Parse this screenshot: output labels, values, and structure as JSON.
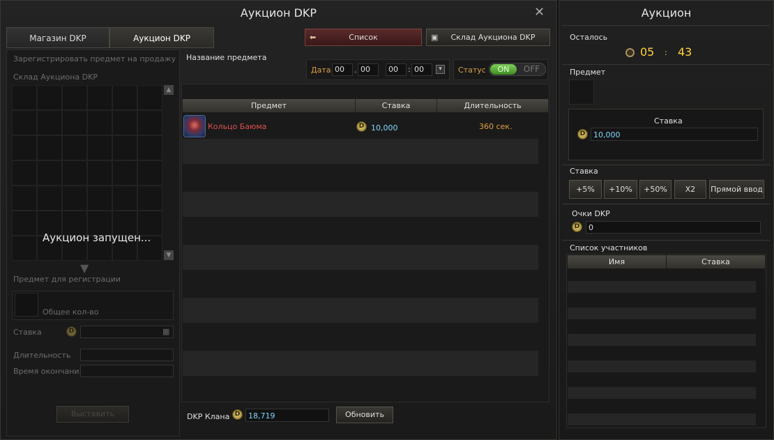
{
  "main": {
    "title": "Аукцион DKP",
    "tabs": [
      {
        "label": "Магазин DKP"
      },
      {
        "label": "Аукцион DKP"
      }
    ],
    "list_button": "Список",
    "warehouse_button": "Склад Аукциона DKP",
    "left": {
      "register_label": "Зарегистрировать предмет на продажу",
      "warehouse_label": "Склад Аукциона DKP",
      "overlay_text": "Аукцион запущен...",
      "item_for_reg_label": "Предмет для регистрации",
      "total_qty_label": "Общее кол-во",
      "bid_label": "Ставка",
      "duration_label": "Длительность",
      "end_time_label": "Время окончания",
      "submit_button": "Выставить"
    },
    "filter": {
      "item_name_label": "Название предмета",
      "date_label": "Дата",
      "date_month": "00",
      "date_day": "00",
      "time_hour": "00",
      "time_min": "00",
      "status_label": "Статус",
      "toggle_on": "ON",
      "toggle_off": "OFF"
    },
    "table": {
      "columns": [
        "Предмет",
        "Ставка",
        "Длительность"
      ],
      "rows": [
        {
          "item": "Кольцо Баюма",
          "bid": "10,000",
          "duration": "360 сек."
        }
      ]
    },
    "footer": {
      "clan_dkp_label": "DKP Клана",
      "clan_dkp_value": "18,719",
      "refresh_button": "Обновить"
    },
    "colors": {
      "item_name": "#e05050",
      "bid_value": "#7fd8ff",
      "duration": "#e0a040"
    }
  },
  "side": {
    "title": "Аукцион",
    "remaining_label": "Осталось",
    "timer_min": "05",
    "timer_sep": ":",
    "timer_sec": "43",
    "item_label": "Предмет",
    "bid_box_label": "Ставка",
    "bid_box_value": "10,000",
    "bid_section_label": "Ставка",
    "bid_buttons": [
      "+5%",
      "+10%",
      "+50%",
      "X2",
      "Прямой ввод"
    ],
    "dkp_points_label": "Очки DKP",
    "dkp_points_value": "0",
    "participants_label": "Список участников",
    "participants_columns": [
      "Имя",
      "Ставка"
    ]
  },
  "icons": {
    "coin": "D"
  }
}
